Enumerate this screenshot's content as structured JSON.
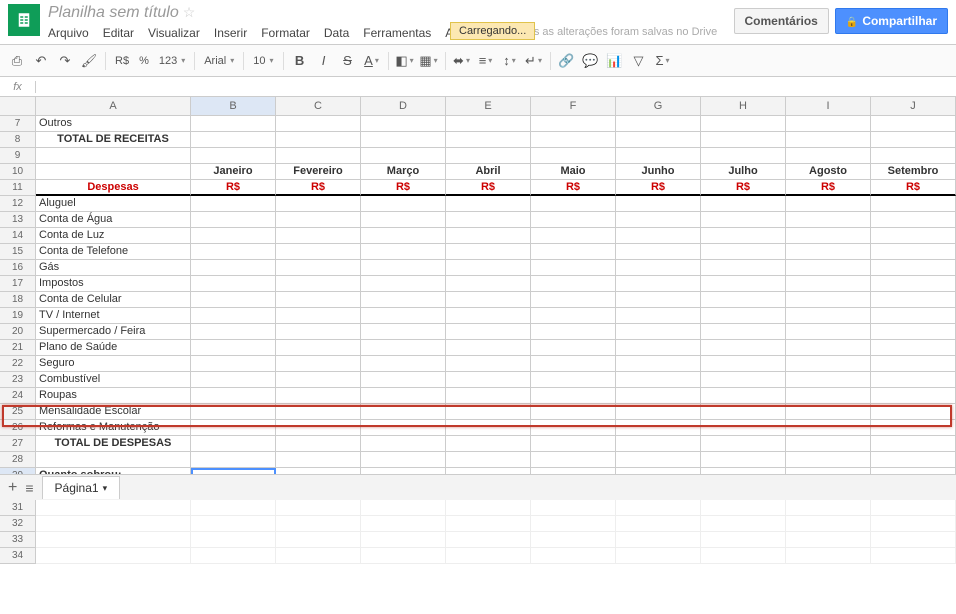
{
  "header": {
    "title": "Planilha sem título",
    "drive_status": "Todas as alterações foram salvas no Drive",
    "loading": "Carregando...",
    "comments": "Comentários",
    "share": "Compartilhar"
  },
  "menus": [
    "Arquivo",
    "Editar",
    "Visualizar",
    "Inserir",
    "Formatar",
    "Data",
    "Ferramentas",
    "Ajuda"
  ],
  "toolbar": {
    "currency": "R$",
    "percent": "%",
    "decimals": "123",
    "font": "Arial",
    "size": "10"
  },
  "fx": "fx",
  "columns": [
    "A",
    "B",
    "C",
    "D",
    "E",
    "F",
    "G",
    "H",
    "I",
    "J"
  ],
  "months": [
    "Janeiro",
    "Fevereiro",
    "Março",
    "Abril",
    "Maio",
    "Junho",
    "Julho",
    "Agosto",
    "Setembro"
  ],
  "currency_lbl": "R$",
  "rows": {
    "r7": "Outros",
    "r8": "TOTAL DE RECEITAS",
    "r11": "Despesas",
    "r12": "Aluguel",
    "r13": "Conta de Água",
    "r14": "Conta de Luz",
    "r15": "Conta de Telefone",
    "r16": "Gás",
    "r17": "Impostos",
    "r18": "Conta de Celular",
    "r19": "TV / Internet",
    "r20": "Supermercado / Feira",
    "r21": "Plano de Saúde",
    "r22": "Seguro",
    "r23": "Combustível",
    "r24": "Roupas",
    "r25": "Mensalidade Escolar",
    "r26": "Reformas e Manutenção",
    "r27": "TOTAL DE DESPESAS",
    "r29": "Quanto sobrou:"
  },
  "tab": "Página1",
  "chart_data": null
}
